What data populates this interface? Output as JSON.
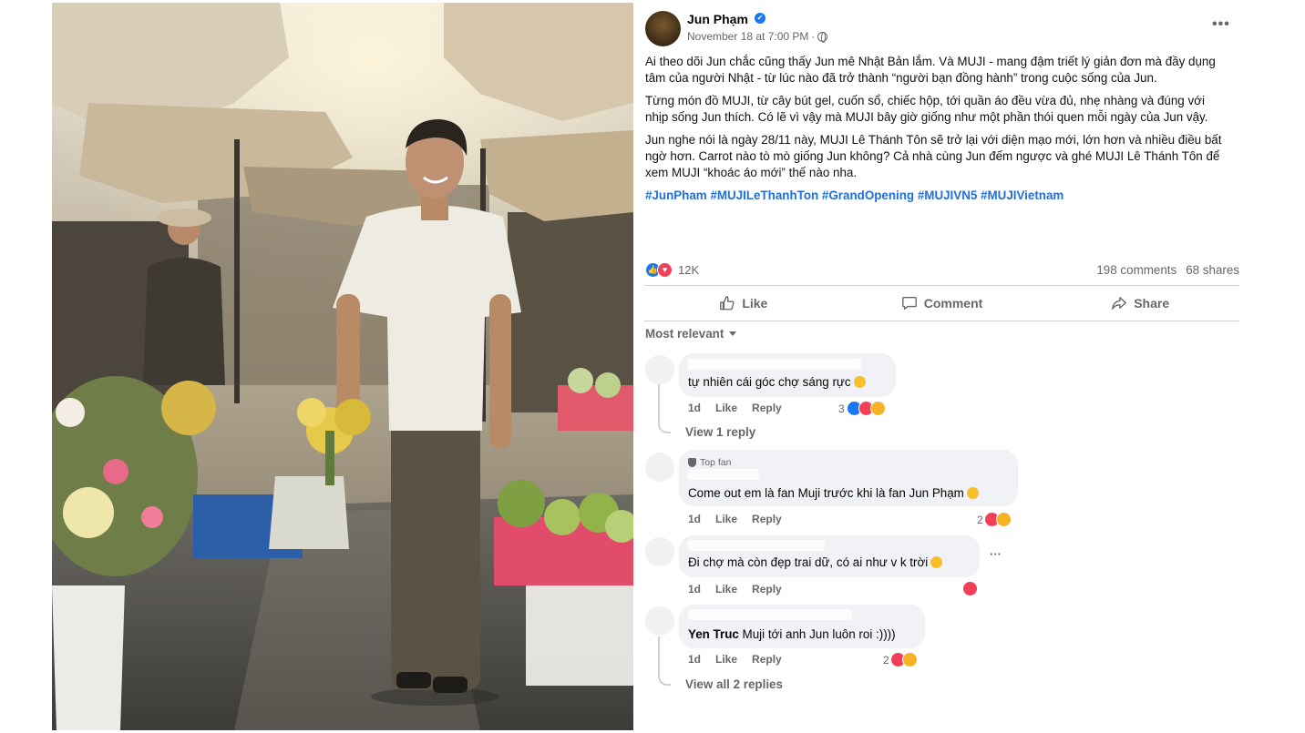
{
  "post": {
    "author": "Jun Phạm",
    "verified_mark": "✔",
    "timestamp": "November 18 at 7:00 PM",
    "separator": "·",
    "more_label": "•••",
    "paragraphs": [
      "Ai theo dõi Jun chắc cũng thấy Jun mê Nhật Bản lắm. Và MUJI - mang đậm triết lý giản đơn mà đầy dụng tâm của người Nhật - từ lúc nào đã trở thành “người bạn đồng hành” trong cuộc sống của Jun.",
      "Từng món đồ MUJI, từ cây bút gel, cuốn sổ, chiếc hộp, tới quần áo đều vừa đủ, nhẹ nhàng và đúng với nhịp sống Jun thích. Có lẽ vì vậy mà MUJI bây giờ giống như một phần thói quen mỗi ngày của Jun vậy.",
      "Jun nghe nói là ngày 28/11 này, MUJI Lê Thánh Tôn sẽ trở lại với diện mạo mới, lớn hơn và nhiều điều bất ngờ hơn. Carrot nào tò mò giống Jun không? Cả nhà cùng Jun đếm ngược và ghé MUJI Lê Thánh Tôn để xem MUJI “khoác áo mới” thế nào nha."
    ],
    "hashtags": "#JunPham #MUJILeThanhTon #GrandOpening #MUJIVN5 #MUJIVietnam",
    "reaction_count": "12K",
    "comments_count": "198 comments",
    "shares_count": "68 shares",
    "actions": {
      "like": "Like",
      "comment": "Comment",
      "share": "Share"
    },
    "sort_label": "Most relevant"
  },
  "colors": {
    "brand": "#1877f2",
    "hashtag": "#216fdb",
    "love": "#f33e58",
    "haha": "#f7b125",
    "muted": "#65676b"
  },
  "comments": [
    {
      "name": "",
      "text": "tự nhiên cái góc chợ sáng rực",
      "time": "1d",
      "like": "Like",
      "reply": "Reply",
      "reaction_count": "3",
      "replies": "View 1 reply"
    },
    {
      "badge": "Top fan",
      "name": "",
      "text": "Come out em là fan Muji trước khi là fan Jun Phạm",
      "time": "1d",
      "like": "Like",
      "reply": "Reply",
      "reaction_count": "2"
    },
    {
      "name": "",
      "text": "Đi chợ mà còn đẹp trai dữ, có ai như v k trời",
      "time": "1d",
      "like": "Like",
      "reply": "Reply",
      "more": "···"
    },
    {
      "name": "",
      "mention": "Yen Truc",
      "text": " Muji tới anh Jun luôn roi :))))",
      "time": "1d",
      "like": "Like",
      "reply": "Reply",
      "reaction_count": "2",
      "replies": "View all 2 replies"
    }
  ]
}
